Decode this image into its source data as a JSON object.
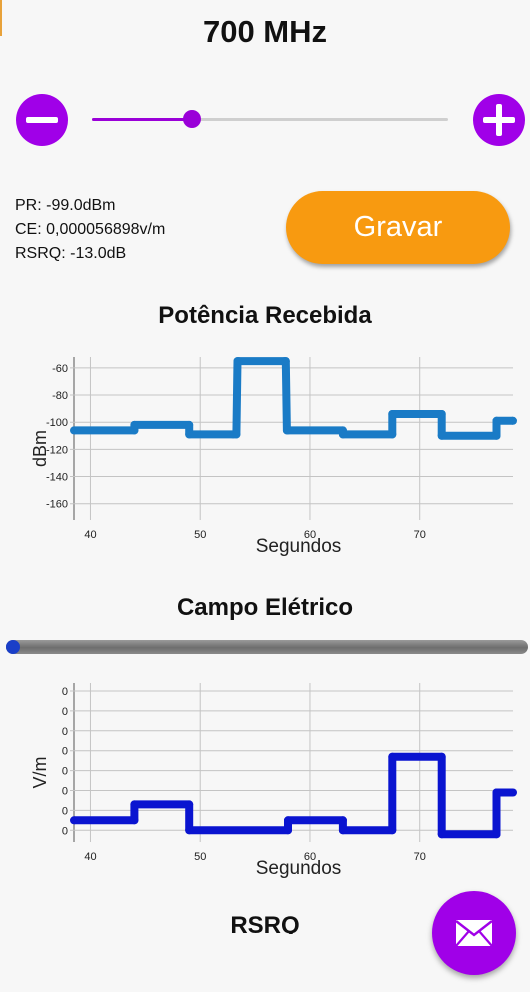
{
  "header": {
    "frequency": "700 MHz"
  },
  "slider": {
    "value_fraction": 0.28
  },
  "readings": {
    "pr": "PR: -99.0dBm",
    "ce": "CE: 0,000056898v/m",
    "rsrq": "RSRQ: -13.0dB"
  },
  "record_button": {
    "label": "Gravar"
  },
  "colors": {
    "accent_purple": "#a000e8",
    "record_orange": "#f89a10",
    "power_line": "#1a7bc6",
    "field_line": "#0a14d0"
  },
  "icons": {
    "minus": "minus-icon",
    "plus": "plus-icon",
    "fab": "mail-icon"
  },
  "chart_data": [
    {
      "type": "line",
      "title": "Potência Recebida",
      "xlabel": "Segundos",
      "ylabel": "dBm",
      "xlim": [
        38.5,
        78.5
      ],
      "ylim": [
        -172,
        -52
      ],
      "xticks": [
        "40",
        "50",
        "60",
        "70"
      ],
      "yticks": [
        "-60",
        "-80",
        "-100",
        "-120",
        "-140",
        "-160"
      ],
      "grid": true,
      "series": [
        {
          "x": [
            38.5,
            44,
            44,
            49,
            49,
            53,
            53.3,
            53.4,
            53.5,
            57.7,
            57.8,
            57.9,
            58,
            63,
            63,
            67.5,
            67.5,
            72,
            72,
            77,
            77,
            78.5
          ],
          "y": [
            -106,
            -106,
            -102,
            -102,
            -109,
            -109,
            -109,
            -55,
            -55,
            -55,
            -55,
            -106,
            -106,
            -106,
            -109,
            -109,
            -94,
            -94,
            -110,
            -110,
            -99,
            -99
          ]
        }
      ]
    },
    {
      "type": "line",
      "title": "Campo Elétrico",
      "xlabel": "Segundos",
      "ylabel": "V/m",
      "xlim": [
        38.5,
        78.5
      ],
      "xticks": [
        "40",
        "50",
        "60",
        "70"
      ],
      "yticks": [
        "0",
        "0",
        "0",
        "0",
        "0",
        "0",
        "0",
        "0"
      ],
      "grid": true,
      "progress_fraction": 0.01,
      "series": [
        {
          "x": [
            38.5,
            44,
            44,
            49,
            49,
            58,
            58,
            63,
            63,
            67.5,
            67.5,
            72,
            72,
            77,
            77,
            78.5
          ],
          "y": [
            0.5,
            0.5,
            1.3,
            1.3,
            0.0,
            0.0,
            0.5,
            0.5,
            0.0,
            0.0,
            3.7,
            3.7,
            -0.2,
            -0.2,
            1.9,
            1.9
          ]
        }
      ]
    },
    {
      "type": "line",
      "title": "RSRQ"
    }
  ]
}
